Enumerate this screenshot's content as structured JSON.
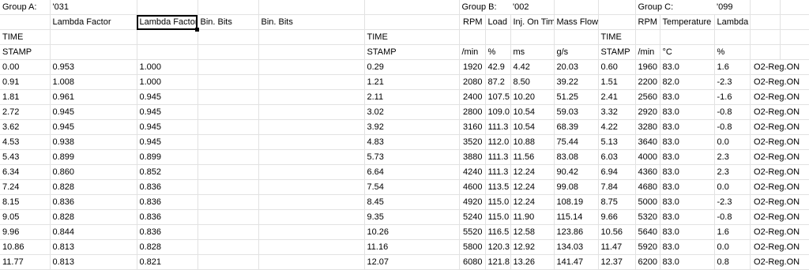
{
  "group_a": {
    "label": "Group A:",
    "code": "'031",
    "col1": "Lambda Factor",
    "col2": "Lambda Factor",
    "col3": "Bin. Bits",
    "col4": "Bin. Bits"
  },
  "group_b": {
    "label": "Group B:",
    "code": "'002",
    "rpm": "RPM",
    "load": "Load",
    "inj": "Inj. On Time",
    "mass": "Mass Flow",
    "u_rpm": "/min",
    "u_load": "%",
    "u_inj": "ms",
    "u_mass": "g/s"
  },
  "group_c": {
    "label": "Group C:",
    "code": "'099",
    "rpm": "RPM",
    "temp": "Temperature",
    "lambda": "Lambda",
    "u_rpm": "/min",
    "u_temp": "°C",
    "u_lambda": "%"
  },
  "time_label": "TIME",
  "stamp_label": "STAMP",
  "rows": [
    {
      "ta": "0.00",
      "l1": "0.953",
      "l2": "1.000",
      "tb": "0.29",
      "rpm": "1920",
      "load": "42.9",
      "inj": "4.42",
      "mass": "20.03",
      "tc": "0.60",
      "crpm": "1960",
      "temp": "83.0",
      "lam": "1.6",
      "status": "O2-Reg.ON"
    },
    {
      "ta": "0.91",
      "l1": "1.008",
      "l2": "1.000",
      "tb": "1.21",
      "rpm": "2080",
      "load": "87.2",
      "inj": "8.50",
      "mass": "39.22",
      "tc": "1.51",
      "crpm": "2200",
      "temp": "82.0",
      "lam": "-2.3",
      "status": "O2-Reg.ON"
    },
    {
      "ta": "1.81",
      "l1": "0.961",
      "l2": "0.945",
      "tb": "2.11",
      "rpm": "2400",
      "load": "107.5",
      "inj": "10.20",
      "mass": "51.25",
      "tc": "2.41",
      "crpm": "2560",
      "temp": "83.0",
      "lam": "-1.6",
      "status": "O2-Reg.ON"
    },
    {
      "ta": "2.72",
      "l1": "0.945",
      "l2": "0.945",
      "tb": "3.02",
      "rpm": "2800",
      "load": "109.0",
      "inj": "10.54",
      "mass": "59.03",
      "tc": "3.32",
      "crpm": "2920",
      "temp": "83.0",
      "lam": "-0.8",
      "status": "O2-Reg.ON"
    },
    {
      "ta": "3.62",
      "l1": "0.945",
      "l2": "0.945",
      "tb": "3.92",
      "rpm": "3160",
      "load": "111.3",
      "inj": "10.54",
      "mass": "68.39",
      "tc": "4.22",
      "crpm": "3280",
      "temp": "83.0",
      "lam": "-0.8",
      "status": "O2-Reg.ON"
    },
    {
      "ta": "4.53",
      "l1": "0.938",
      "l2": "0.945",
      "tb": "4.83",
      "rpm": "3520",
      "load": "112.0",
      "inj": "10.88",
      "mass": "75.44",
      "tc": "5.13",
      "crpm": "3640",
      "temp": "83.0",
      "lam": "0.0",
      "status": "O2-Reg.ON"
    },
    {
      "ta": "5.43",
      "l1": "0.899",
      "l2": "0.899",
      "tb": "5.73",
      "rpm": "3880",
      "load": "111.3",
      "inj": "11.56",
      "mass": "83.08",
      "tc": "6.03",
      "crpm": "4000",
      "temp": "83.0",
      "lam": "2.3",
      "status": "O2-Reg.ON"
    },
    {
      "ta": "6.34",
      "l1": "0.860",
      "l2": "0.852",
      "tb": "6.64",
      "rpm": "4240",
      "load": "111.3",
      "inj": "12.24",
      "mass": "90.42",
      "tc": "6.94",
      "crpm": "4360",
      "temp": "83.0",
      "lam": "2.3",
      "status": "O2-Reg.ON"
    },
    {
      "ta": "7.24",
      "l1": "0.828",
      "l2": "0.836",
      "tb": "7.54",
      "rpm": "4600",
      "load": "113.5",
      "inj": "12.24",
      "mass": "99.08",
      "tc": "7.84",
      "crpm": "4680",
      "temp": "83.0",
      "lam": "0.0",
      "status": "O2-Reg.ON"
    },
    {
      "ta": "8.15",
      "l1": "0.836",
      "l2": "0.836",
      "tb": "8.45",
      "rpm": "4920",
      "load": "115.0",
      "inj": "12.24",
      "mass": "108.19",
      "tc": "8.75",
      "crpm": "5000",
      "temp": "83.0",
      "lam": "-2.3",
      "status": "O2-Reg.ON"
    },
    {
      "ta": "9.05",
      "l1": "0.828",
      "l2": "0.836",
      "tb": "9.35",
      "rpm": "5240",
      "load": "115.0",
      "inj": "11.90",
      "mass": "115.14",
      "tc": "9.66",
      "crpm": "5320",
      "temp": "83.0",
      "lam": "-0.8",
      "status": "O2-Reg.ON"
    },
    {
      "ta": "9.96",
      "l1": "0.844",
      "l2": "0.836",
      "tb": "10.26",
      "rpm": "5520",
      "load": "116.5",
      "inj": "12.58",
      "mass": "123.86",
      "tc": "10.56",
      "crpm": "5640",
      "temp": "83.0",
      "lam": "1.6",
      "status": "O2-Reg.ON"
    },
    {
      "ta": "10.86",
      "l1": "0.813",
      "l2": "0.828",
      "tb": "11.16",
      "rpm": "5800",
      "load": "120.3",
      "inj": "12.92",
      "mass": "134.03",
      "tc": "11.47",
      "crpm": "5920",
      "temp": "83.0",
      "lam": "0.0",
      "status": "O2-Reg.ON"
    },
    {
      "ta": "11.77",
      "l1": "0.813",
      "l2": "0.821",
      "tb": "12.07",
      "rpm": "6080",
      "load": "121.8",
      "inj": "13.26",
      "mass": "141.47",
      "tc": "12.37",
      "crpm": "6200",
      "temp": "83.0",
      "lam": "0.8",
      "status": "O2-Reg.ON"
    }
  ]
}
